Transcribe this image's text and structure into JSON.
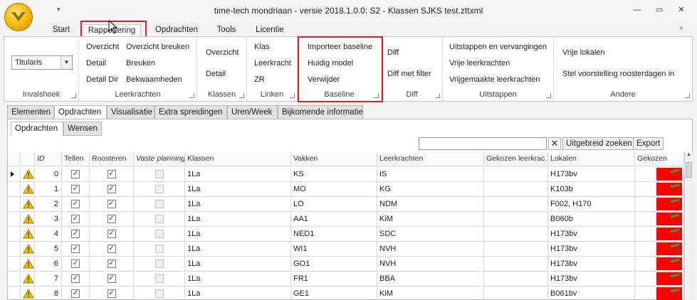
{
  "window": {
    "title": "time-tech mondriaan - versie 2018.1.0.0: S2 - Klassen SJKS test.zttxml",
    "minimize": "—",
    "restore": "▭",
    "close": "✕",
    "qat_glyph": "▾",
    "help_glyph": "^"
  },
  "ribbon_tabs": [
    {
      "label": "Start"
    },
    {
      "label": "Rapportering"
    },
    {
      "label": "Opdrachten"
    },
    {
      "label": "Tools"
    },
    {
      "label": "Licentie"
    }
  ],
  "ribbon": {
    "invalshoek": {
      "label": "Invalshoek",
      "combo_value": "Titularis"
    },
    "leerkrachten": {
      "label": "Leerkrachten",
      "buttons": [
        "Overzicht",
        "Overzicht breuken",
        "Detail",
        "Breuken",
        "Detail Dir",
        "Bekwaamheden"
      ]
    },
    "klassen": {
      "label": "Klassen",
      "buttons": [
        "Overzicht",
        "Detail"
      ]
    },
    "linken": {
      "label": "Linken",
      "buttons": [
        "Klas",
        "Leerkracht",
        "ZR"
      ]
    },
    "baseline": {
      "label": "Baseline",
      "buttons": [
        "Importeer baseline",
        "Huidig model",
        "Verwijder"
      ]
    },
    "diff": {
      "label": "Diff",
      "buttons": [
        "Diff",
        "Diff met filter"
      ]
    },
    "uitstappen": {
      "label": "Uitstappen",
      "buttons": [
        "Uitstappen en vervangingen",
        "Vrije leerkrachten",
        "Vrijgemaakte leerkrachten"
      ]
    },
    "andere": {
      "label": "Andere",
      "buttons": [
        "Vrije lokalen",
        "Stel voorstelling roosterdagen in"
      ]
    }
  },
  "content_tabs": [
    {
      "label": "Elementen"
    },
    {
      "label": "Opdrachten"
    },
    {
      "label": "Visualisatie"
    },
    {
      "label": "Extra spreidingen"
    },
    {
      "label": "Uren/Week"
    },
    {
      "label": "Bijkomende informatie"
    }
  ],
  "sub_tabs": [
    {
      "label": "Opdrachten"
    },
    {
      "label": "Wensen"
    }
  ],
  "toolbar": {
    "search_value": "",
    "clear_label": "✕",
    "extended_search": "Uitgebreid zoeken",
    "export": "Export"
  },
  "grid": {
    "columns": [
      "ID",
      "Tellen",
      "Roosteren",
      "Vaste planning",
      "Klassen",
      "Vakken",
      "Leerkrachten",
      "Gekozen leerkrac...",
      "Lokalen",
      "Gekozen"
    ],
    "rows": [
      {
        "id": "0",
        "tellen": true,
        "roosteren": true,
        "vaste": false,
        "klassen": "1La",
        "vakken": "KS",
        "leerkrachten": "IS",
        "gekozen_lk": "",
        "lokalen": "H173bv"
      },
      {
        "id": "1",
        "tellen": true,
        "roosteren": true,
        "vaste": false,
        "klassen": "1La",
        "vakken": "MO",
        "leerkrachten": "KG",
        "gekozen_lk": "",
        "lokalen": "K103b"
      },
      {
        "id": "2",
        "tellen": true,
        "roosteren": true,
        "vaste": false,
        "klassen": "1La",
        "vakken": "LO",
        "leerkrachten": "NDM",
        "gekozen_lk": "",
        "lokalen": "F002, H170"
      },
      {
        "id": "3",
        "tellen": true,
        "roosteren": true,
        "vaste": false,
        "klassen": "1La",
        "vakken": "AA1",
        "leerkrachten": "KiM",
        "gekozen_lk": "",
        "lokalen": "B060b"
      },
      {
        "id": "4",
        "tellen": true,
        "roosteren": true,
        "vaste": false,
        "klassen": "1La",
        "vakken": "NED1",
        "leerkrachten": "SDC",
        "gekozen_lk": "",
        "lokalen": "H173bv"
      },
      {
        "id": "5",
        "tellen": true,
        "roosteren": true,
        "vaste": false,
        "klassen": "1La",
        "vakken": "WI1",
        "leerkrachten": "NVH",
        "gekozen_lk": "",
        "lokalen": "H173bv"
      },
      {
        "id": "6",
        "tellen": true,
        "roosteren": true,
        "vaste": false,
        "klassen": "1La",
        "vakken": "GO1",
        "leerkrachten": "NVH",
        "gekozen_lk": "",
        "lokalen": "H173bv"
      },
      {
        "id": "7",
        "tellen": true,
        "roosteren": true,
        "vaste": false,
        "klassen": "1La",
        "vakken": "FR1",
        "leerkrachten": "BBA",
        "gekozen_lk": "",
        "lokalen": "H173bv"
      },
      {
        "id": "8",
        "tellen": true,
        "roosteren": true,
        "vaste": false,
        "klassen": "1La",
        "vakken": "GE1",
        "leerkrachten": "KiM",
        "gekozen_lk": "",
        "lokalen": "B061bv"
      }
    ]
  },
  "colors": {
    "highlight_box": "#e02020",
    "status_red": "#ff0000",
    "warning": "#f5c400"
  },
  "icons": {
    "warning": "warning-triangle-icon",
    "check": "checkmark-icon",
    "row_indicator": "current-row-icon"
  }
}
